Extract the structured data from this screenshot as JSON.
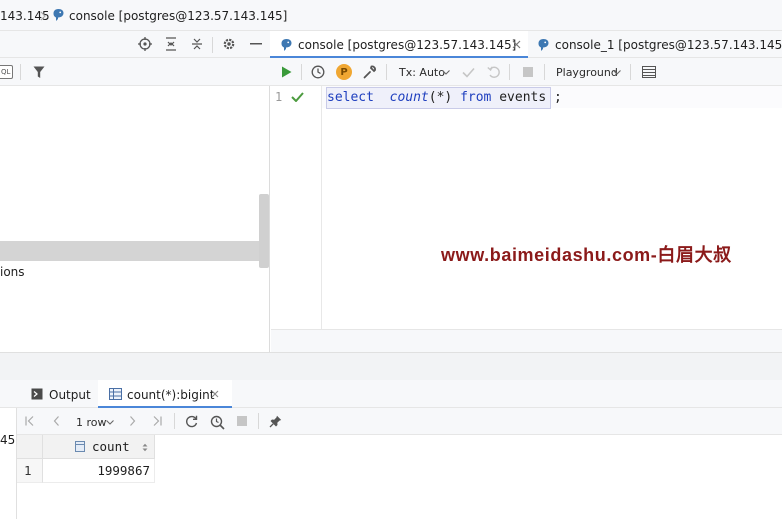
{
  "breadcrumb": {
    "host_fragment": "143.145",
    "console_title": "console [postgres@123.57.143.145]"
  },
  "left_panel": {
    "toolbar_badge": "QL",
    "partial_item_text": "ions"
  },
  "editor_tabs": [
    {
      "label": "console [postgres@123.57.143.145]",
      "active": true
    },
    {
      "label": "console_1 [postgres@123.57.143.145]",
      "active": false
    }
  ],
  "editor_toolbar": {
    "tx_mode": "Tx: Auto",
    "schema": "Playground",
    "p_badge": "P"
  },
  "editor": {
    "line_number": "1",
    "code": {
      "kw_select": "select",
      "fn_count": "count",
      "args": "(*)",
      "kw_from": "from",
      "table": "events",
      "semicolon": ";"
    }
  },
  "watermark": "www.baimeidashu.com-白眉大叔",
  "services_tabs": {
    "output_label": "Output",
    "result_label": "count(*):bigint"
  },
  "result_toolbar": {
    "rows": "1 row"
  },
  "result_grid": {
    "columns": [
      "count"
    ],
    "rows": [
      {
        "num": "1",
        "cells": [
          "1999867"
        ]
      }
    ]
  },
  "left_strip_text": "45",
  "colors": {
    "accent_blue": "#4a86d8",
    "run_green": "#3a9a3a",
    "keyword": "#1f3fbf",
    "function": "#1f3fbf",
    "watermark_red": "#8b1a1a",
    "postgres_icon": "#3e78b2"
  }
}
